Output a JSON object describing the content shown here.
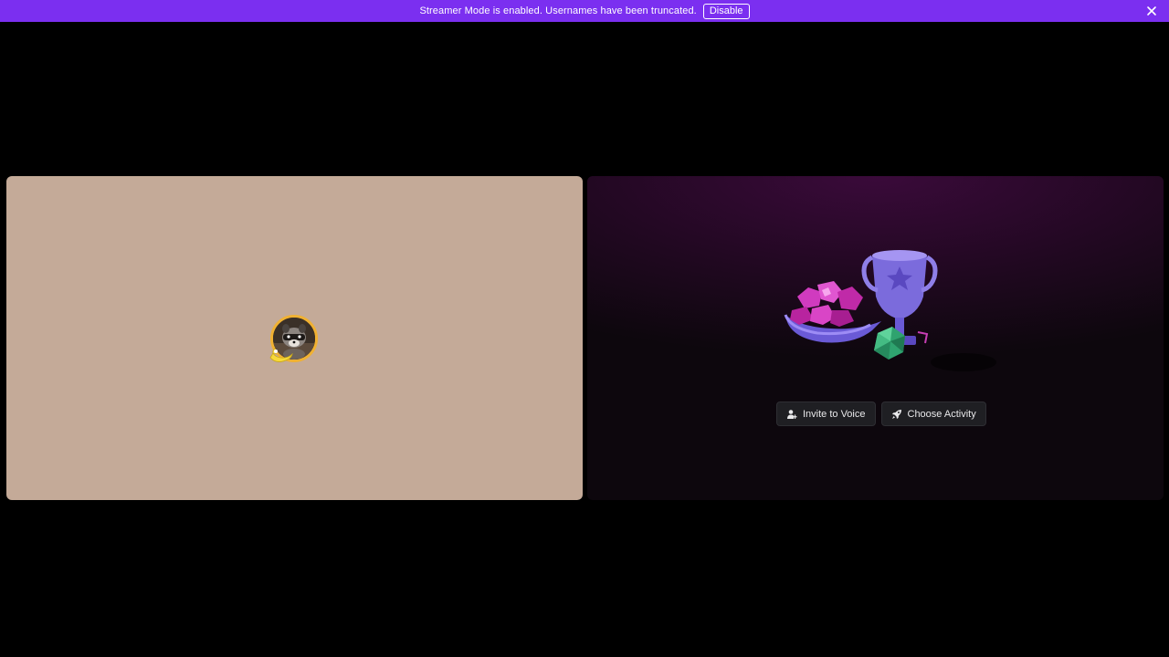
{
  "banner": {
    "message": "Streamer Mode is enabled. Usernames have been truncated.",
    "disable_label": "Disable",
    "close_icon": "close-icon",
    "color": "#7b2ff0"
  },
  "user_tile": {
    "background_color": "#c4aa98",
    "avatar_ring_color": "#f0b132",
    "avatar": "raccoon-avatar",
    "decoration": "banana-icon"
  },
  "activity_tile": {
    "illustration": "trophy-gems-dice-illustration",
    "buttons": [
      {
        "label": "Invite to Voice",
        "icon": "add-user-icon"
      },
      {
        "label": "Choose Activity",
        "icon": "rocket-icon"
      }
    ]
  }
}
